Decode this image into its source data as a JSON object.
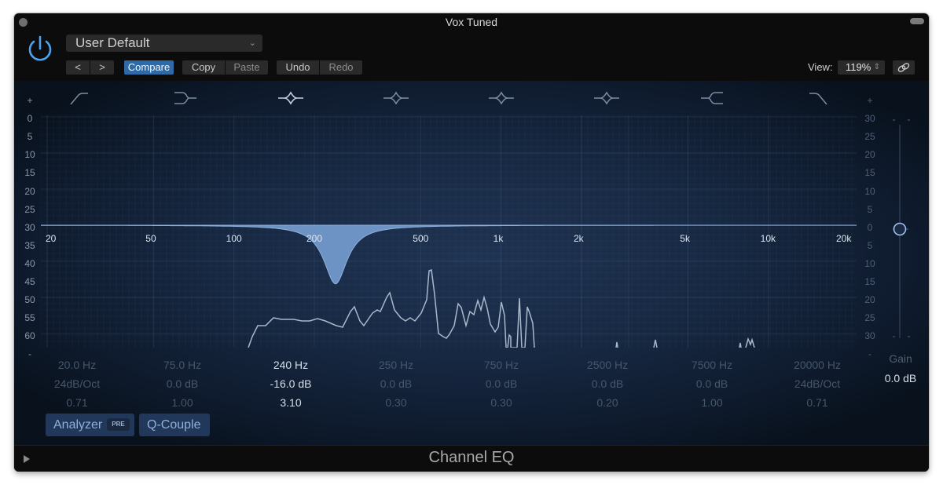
{
  "window": {
    "title": "Vox Tuned"
  },
  "header": {
    "preset": "User Default",
    "nav_prev": "<",
    "nav_next": ">",
    "compare": "Compare",
    "copy": "Copy",
    "paste": "Paste",
    "undo": "Undo",
    "redo": "Redo",
    "view_label": "View:",
    "view_value": "119%"
  },
  "graph": {
    "left_scale": [
      "+",
      "0",
      "5",
      "10",
      "15",
      "20",
      "25",
      "30",
      "35",
      "40",
      "45",
      "50",
      "55",
      "60",
      "-"
    ],
    "right_scale": [
      "+",
      "30",
      "25",
      "20",
      "15",
      "10",
      "5",
      "0",
      "5",
      "10",
      "15",
      "20",
      "25",
      "30",
      "-"
    ],
    "freq_labels": [
      "20",
      "50",
      "100",
      "200",
      "500",
      "1k",
      "2k",
      "5k",
      "10k",
      "20k"
    ],
    "eq_curve": {
      "freq_hz": 240,
      "gain_db": -16.0,
      "q": 3.1
    },
    "colors": {
      "curve_fill": "#6c93c4",
      "analyzer": "#a9b8ca",
      "accent": "#2f6aa7"
    }
  },
  "bands": [
    {
      "type": "low-cut",
      "freq": "20.0 Hz",
      "gain": "24dB/Oct",
      "q": "0.71",
      "selected": false
    },
    {
      "type": "low-shelf",
      "freq": "75.0 Hz",
      "gain": "0.0 dB",
      "q": "1.00",
      "selected": false
    },
    {
      "type": "bell",
      "freq": "240 Hz",
      "gain": "-16.0 dB",
      "q": "3.10",
      "selected": true
    },
    {
      "type": "bell",
      "freq": "250 Hz",
      "gain": "0.0 dB",
      "q": "0.30",
      "selected": false
    },
    {
      "type": "bell",
      "freq": "750 Hz",
      "gain": "0.0 dB",
      "q": "0.30",
      "selected": false
    },
    {
      "type": "bell",
      "freq": "2500 Hz",
      "gain": "0.0 dB",
      "q": "0.20",
      "selected": false
    },
    {
      "type": "high-shelf",
      "freq": "7500 Hz",
      "gain": "0.0 dB",
      "q": "1.00",
      "selected": false
    },
    {
      "type": "high-cut",
      "freq": "20000 Hz",
      "gain": "24dB/Oct",
      "q": "0.71",
      "selected": false
    }
  ],
  "master_gain": {
    "label": "Gain",
    "value": "0.0 dB",
    "level_db": 0
  },
  "toggles": {
    "analyzer": "Analyzer",
    "analyzer_mode": "PRE",
    "q_couple": "Q-Couple"
  },
  "footer": {
    "plugin_name": "Channel EQ"
  }
}
